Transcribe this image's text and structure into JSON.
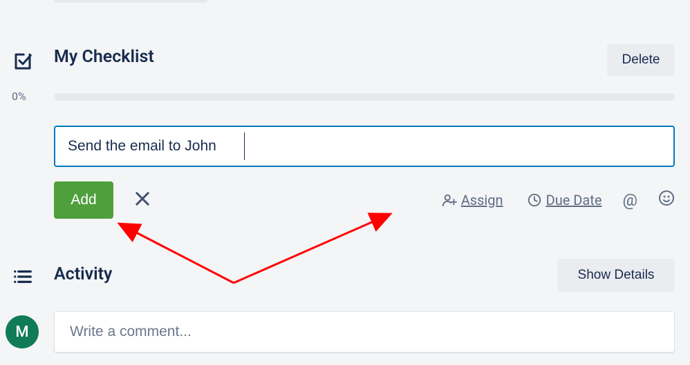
{
  "checklist": {
    "title": "My Checklist",
    "delete_label": "Delete",
    "percent_label": "0%",
    "item_input_value": "Send the email to John",
    "add_label": "Add",
    "assign_label": "Assign",
    "duedate_label": "Due Date"
  },
  "activity": {
    "title": "Activity",
    "showdetails_label": "Show Details",
    "comment_placeholder": "Write a comment...",
    "avatar_initial": "M"
  }
}
